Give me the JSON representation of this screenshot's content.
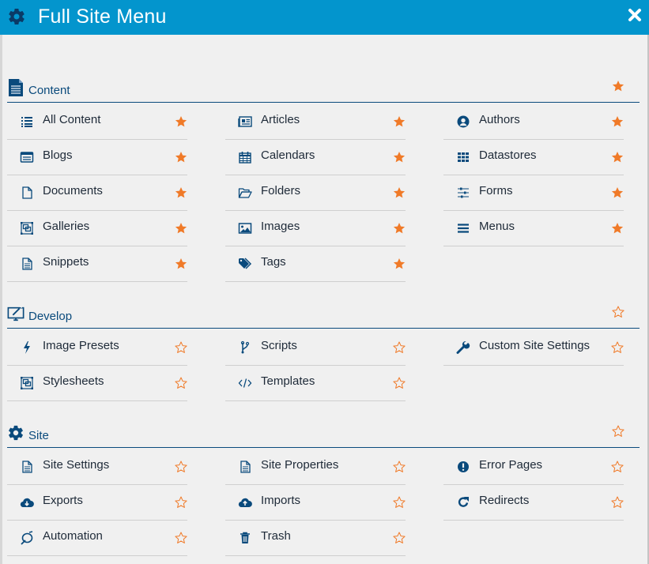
{
  "header": {
    "title": "Full Site Menu",
    "icon": "gear-icon",
    "close_icon": "close-icon"
  },
  "colors": {
    "header_bg": "#0395cd",
    "accent_dark": "#0a4a7c",
    "star": "#f07a28",
    "background": "#f0f0f0"
  },
  "sections": [
    {
      "label": "Content",
      "icon": "document-icon",
      "favorited": true,
      "items": [
        {
          "label": "All Content",
          "icon": "list-icon",
          "favorited": true
        },
        {
          "label": "Articles",
          "icon": "newspaper-icon",
          "favorited": true
        },
        {
          "label": "Authors",
          "icon": "user-circle-icon",
          "favorited": true
        },
        {
          "label": "Blogs",
          "icon": "blog-icon",
          "favorited": true
        },
        {
          "label": "Calendars",
          "icon": "calendar-icon",
          "favorited": true
        },
        {
          "label": "Datastores",
          "icon": "grid-icon",
          "favorited": true
        },
        {
          "label": "Documents",
          "icon": "file-icon",
          "favorited": true
        },
        {
          "label": "Folders",
          "icon": "folder-open-icon",
          "favorited": true
        },
        {
          "label": "Forms",
          "icon": "sliders-icon",
          "favorited": true
        },
        {
          "label": "Galleries",
          "icon": "gallery-icon",
          "favorited": true
        },
        {
          "label": "Images",
          "icon": "image-icon",
          "favorited": true
        },
        {
          "label": "Menus",
          "icon": "hamburger-icon",
          "favorited": true
        },
        {
          "label": "Snippets",
          "icon": "file-text-icon",
          "favorited": true
        },
        {
          "label": "Tags",
          "icon": "tags-icon",
          "favorited": true
        }
      ]
    },
    {
      "label": "Develop",
      "icon": "monitor-edit-icon",
      "favorited": false,
      "items": [
        {
          "label": "Image Presets",
          "icon": "bolt-icon",
          "favorited": false
        },
        {
          "label": "Scripts",
          "icon": "branch-icon",
          "favorited": false
        },
        {
          "label": "Custom Site Settings",
          "icon": "wrench-icon",
          "favorited": false
        },
        {
          "label": "Stylesheets",
          "icon": "gallery-icon",
          "favorited": false
        },
        {
          "label": "Templates",
          "icon": "code-icon",
          "favorited": false
        }
      ]
    },
    {
      "label": "Site",
      "icon": "gear-icon",
      "favorited": false,
      "items": [
        {
          "label": "Site Settings",
          "icon": "file-text-icon",
          "favorited": false
        },
        {
          "label": "Site Properties",
          "icon": "file-text-icon",
          "favorited": false
        },
        {
          "label": "Error Pages",
          "icon": "exclamation-circle-icon",
          "favorited": false
        },
        {
          "label": "Exports",
          "icon": "cloud-download-icon",
          "favorited": false
        },
        {
          "label": "Imports",
          "icon": "cloud-upload-icon",
          "favorited": false
        },
        {
          "label": "Redirects",
          "icon": "redo-icon",
          "favorited": false
        },
        {
          "label": "Automation",
          "icon": "automation-icon",
          "favorited": false
        },
        {
          "label": "Trash",
          "icon": "trash-icon",
          "favorited": false
        }
      ]
    }
  ]
}
